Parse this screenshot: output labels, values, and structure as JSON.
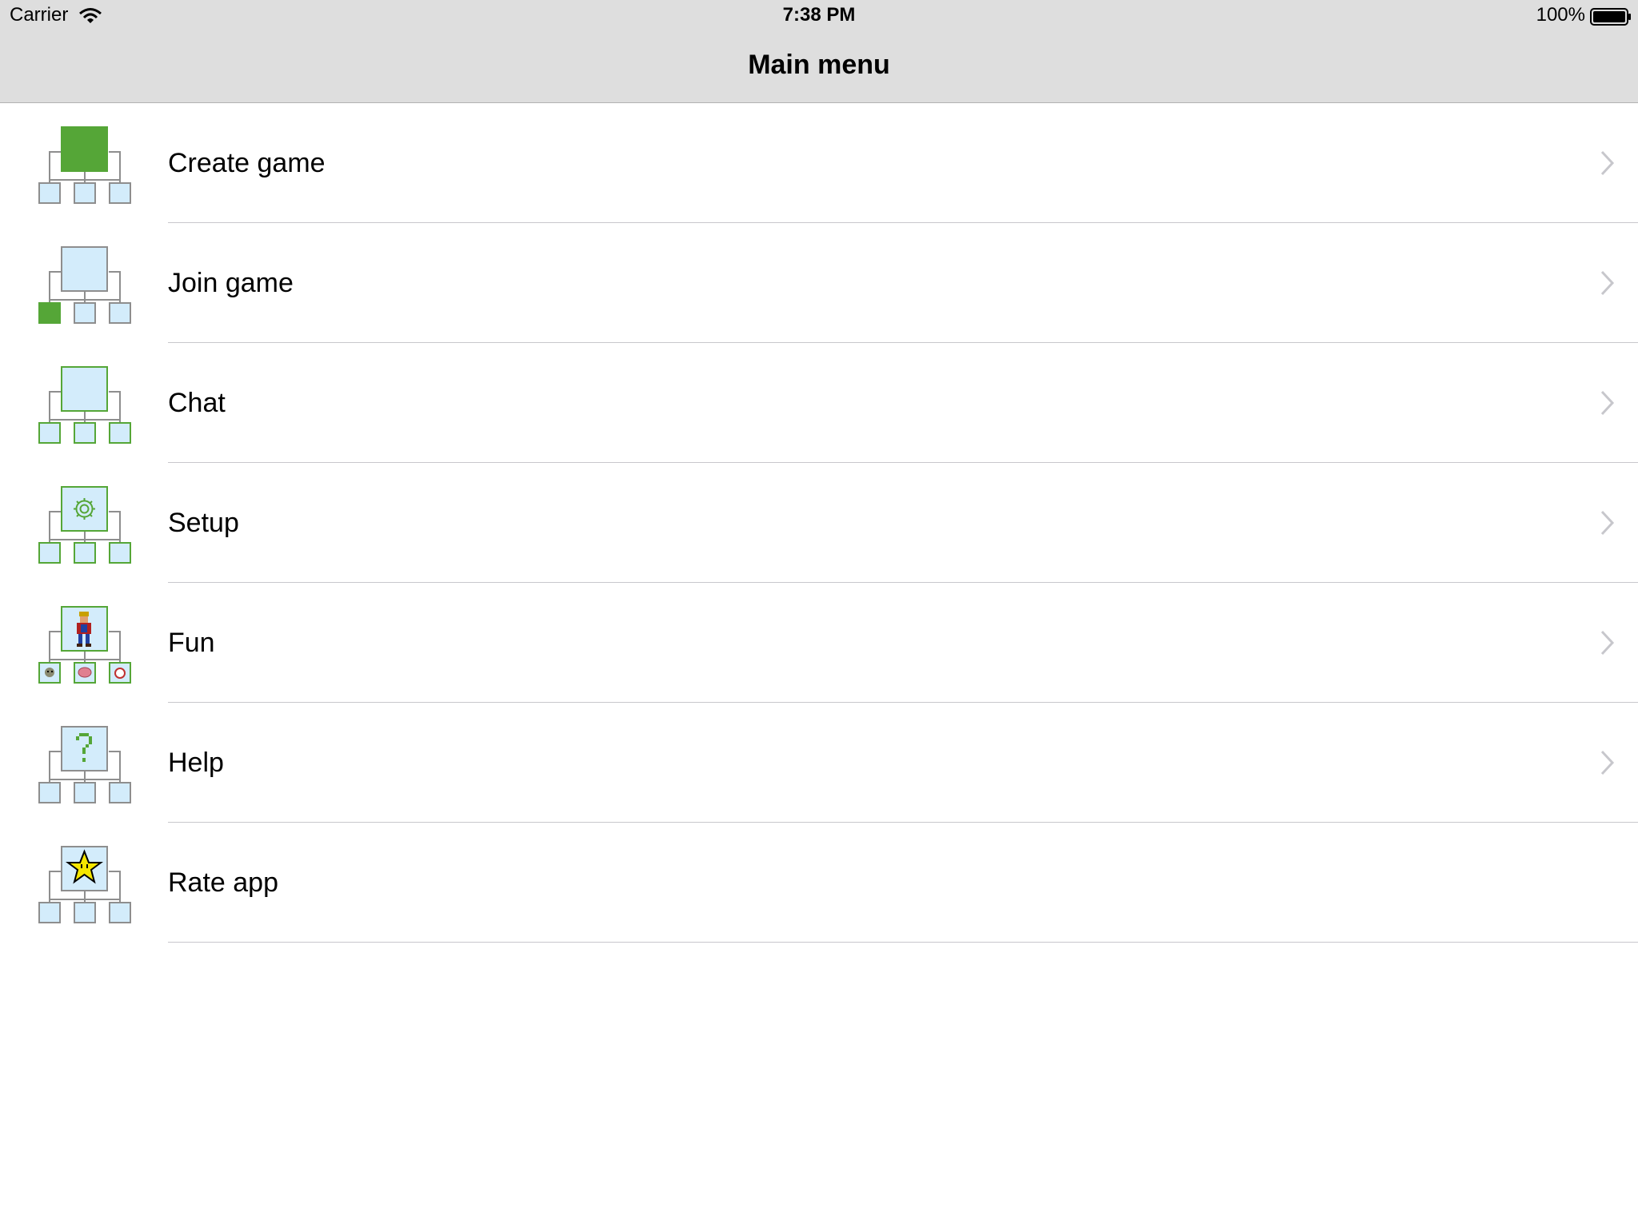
{
  "status_bar": {
    "carrier": "Carrier",
    "time": "7:38 PM",
    "battery": "100%"
  },
  "nav": {
    "title": "Main menu"
  },
  "menu": {
    "items": [
      {
        "label": "Create game",
        "icon": "create-game-tree-icon",
        "has_chevron": true
      },
      {
        "label": "Join game",
        "icon": "join-game-tree-icon",
        "has_chevron": true
      },
      {
        "label": "Chat",
        "icon": "chat-tree-icon",
        "has_chevron": true
      },
      {
        "label": "Setup",
        "icon": "setup-gear-tree-icon",
        "has_chevron": true
      },
      {
        "label": "Fun",
        "icon": "fun-character-tree-icon",
        "has_chevron": true
      },
      {
        "label": "Help",
        "icon": "help-question-tree-icon",
        "has_chevron": true
      },
      {
        "label": "Rate app",
        "icon": "rate-star-tree-icon",
        "has_chevron": false
      }
    ]
  },
  "colors": {
    "accent_green": "#55a637",
    "box_fill": "#d3ecfb",
    "box_border_gray": "#8e8e8e",
    "bar_background": "#dedede"
  }
}
